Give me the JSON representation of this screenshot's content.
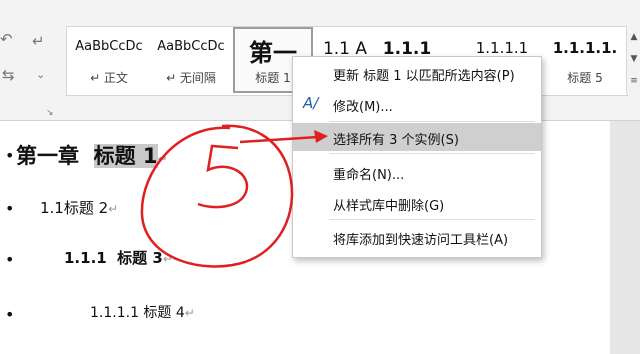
{
  "toolbar": {
    "left_icons": [
      "undo-icon",
      "redo-icon",
      "chevron-icon"
    ],
    "launcher_icon": "dialog-launcher-icon"
  },
  "styles": [
    {
      "sample": "AaBbCcDc",
      "name": "↵ 正文"
    },
    {
      "sample": "AaBbCcDc",
      "name": "↵ 无间隔"
    },
    {
      "sample": "第一",
      "name": "标题 1"
    },
    {
      "sample": "1.1  A",
      "name": ""
    },
    {
      "sample": "1.1.1",
      "name": ""
    },
    {
      "sample": "1.1.1.1",
      "name": ""
    },
    {
      "sample": "1.1.1.1.",
      "name": "标题 5"
    }
  ],
  "document": {
    "heading1": {
      "prefix": "第一章  ",
      "highlight": "标题 1"
    },
    "heading2": "1.1标题 2",
    "heading3": "1.1.1  标题 3",
    "heading4": "1.1.1.1 标题 4",
    "para_mark": "↵"
  },
  "context_menu": {
    "items": [
      {
        "label": "更新 标题 1 以匹配所选内容(P)",
        "icon": ""
      },
      {
        "label": "修改(M)...",
        "icon": "modify-style-icon"
      },
      {
        "label": "选择所有 3 个实例(S)",
        "icon": "",
        "highlighted": true
      },
      {
        "label": "重命名(N)...",
        "icon": ""
      },
      {
        "label": "从样式库中删除(G)",
        "icon": ""
      },
      {
        "label": "将库添加到快速访问工具栏(A)",
        "icon": ""
      }
    ]
  },
  "annotation": {
    "color": "#e02020"
  }
}
